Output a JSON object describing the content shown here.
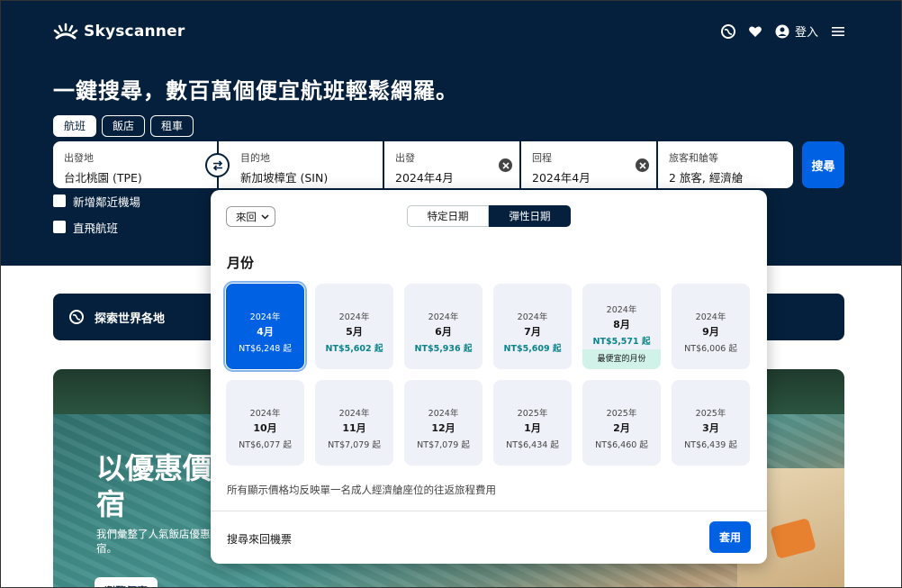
{
  "header": {
    "brand": "Skyscanner",
    "login_label": "登入"
  },
  "hero": {
    "headline": "一鍵搜尋，數百萬個便宜航班輕鬆網羅。",
    "tabs": [
      {
        "label": "航班",
        "active": true
      },
      {
        "label": "飯店",
        "active": false
      },
      {
        "label": "租車",
        "active": false
      }
    ]
  },
  "search": {
    "origin": {
      "label": "出發地",
      "value": "台北桃園 (TPE)"
    },
    "destination": {
      "label": "目的地",
      "value": "新加坡樟宜 (SIN)"
    },
    "depart": {
      "label": "出發",
      "value": "2024年4月"
    },
    "return": {
      "label": "回程",
      "value": "2024年4月"
    },
    "travellers": {
      "label": "旅客和艙等",
      "value": "2 旅客, 經濟艙"
    },
    "search_button": "搜尋",
    "options": [
      "新增鄰近機場",
      "直飛航班"
    ]
  },
  "explore": {
    "label": "探索世界各地"
  },
  "promo": {
    "title": "以優惠價住宿",
    "subtitle": "我們彙整了人氣飯店優惠找到優質住宿。",
    "button": "瀏覽優惠"
  },
  "date_picker": {
    "trip_type": "來回",
    "modes": [
      {
        "label": "特定日期",
        "active": false
      },
      {
        "label": "彈性日期",
        "active": true
      }
    ],
    "months_heading": "月份",
    "months": [
      {
        "year": "2024年",
        "month": "4月",
        "price": "NT$6,248 起",
        "selected": true,
        "cheap": false
      },
      {
        "year": "2024年",
        "month": "5月",
        "price": "NT$5,602 起",
        "selected": false,
        "cheap": true
      },
      {
        "year": "2024年",
        "month": "6月",
        "price": "NT$5,936 起",
        "selected": false,
        "cheap": true
      },
      {
        "year": "2024年",
        "month": "7月",
        "price": "NT$5,609 起",
        "selected": false,
        "cheap": true
      },
      {
        "year": "2024年",
        "month": "8月",
        "price": "NT$5,571 起",
        "selected": false,
        "cheap": true,
        "tag": "最便宜的月份"
      },
      {
        "year": "2024年",
        "month": "9月",
        "price": "NT$6,006 起",
        "selected": false,
        "cheap": false
      },
      {
        "year": "2024年",
        "month": "10月",
        "price": "NT$6,077 起",
        "selected": false,
        "cheap": false
      },
      {
        "year": "2024年",
        "month": "11月",
        "price": "NT$7,079 起",
        "selected": false,
        "cheap": false
      },
      {
        "year": "2024年",
        "month": "12月",
        "price": "NT$7,079 起",
        "selected": false,
        "cheap": false
      },
      {
        "year": "2025年",
        "month": "1月",
        "price": "NT$6,434 起",
        "selected": false,
        "cheap": false
      },
      {
        "year": "2025年",
        "month": "2月",
        "price": "NT$6,460 起",
        "selected": false,
        "cheap": false
      },
      {
        "year": "2025年",
        "month": "3月",
        "price": "NT$6,439 起",
        "selected": false,
        "cheap": false
      }
    ],
    "note": "所有顯示價格均反映單一名成人經濟艙座位的往返旅程費用",
    "footer_label": "搜尋來回機票",
    "apply_button": "套用"
  },
  "colors": {
    "navy": "#05203c",
    "primary_blue": "#0062e3",
    "cheap_green": "#0c838a",
    "cheap_tag_bg": "#d0f2e8",
    "cell_bg": "#eff1f8"
  }
}
